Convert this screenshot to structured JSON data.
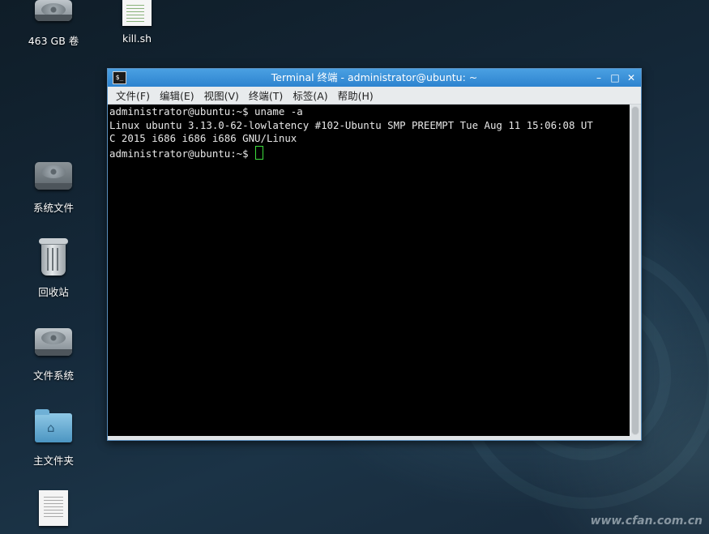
{
  "desktop": {
    "icons": [
      {
        "label": "463 GB 卷",
        "icon": "drive-icon"
      },
      {
        "label": "kill.sh",
        "icon": "script-file-icon"
      },
      {
        "label": "系统文件",
        "icon": "drive-icon"
      },
      {
        "label": "回收站",
        "icon": "trash-icon"
      },
      {
        "label": "文件系统",
        "icon": "drive-icon"
      },
      {
        "label": "主文件夹",
        "icon": "home-folder-icon"
      },
      {
        "label": "",
        "icon": "text-file-icon"
      }
    ],
    "watermark": "www.cfan.com.cn"
  },
  "window": {
    "title": "Terminal 终端 - administrator@ubuntu: ~",
    "app_icon_glyph": "$_",
    "controls": {
      "minimize": "–",
      "maximize": "□",
      "close": "✕"
    },
    "menu": [
      "文件(F)",
      "编辑(E)",
      "视图(V)",
      "终端(T)",
      "标签(A)",
      "帮助(H)"
    ]
  },
  "terminal": {
    "lines": [
      "administrator@ubuntu:~$ uname -a",
      "Linux ubuntu 3.13.0-62-lowlatency #102-Ubuntu SMP PREEMPT Tue Aug 11 15:06:08 UT",
      "C 2015 i686 i686 i686 GNU/Linux"
    ],
    "prompt": "administrator@ubuntu:~$ ",
    "cursor_color": "#3ddc3d"
  },
  "colors": {
    "titlebar": "#2d83cf",
    "terminal_bg": "#000000"
  }
}
